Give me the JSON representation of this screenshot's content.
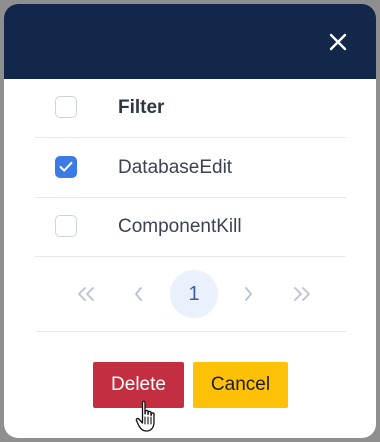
{
  "dialog": {
    "close_icon": "close-icon"
  },
  "table": {
    "header_label": "Filter",
    "rows": [
      {
        "label": "DatabaseEdit",
        "checked": true
      },
      {
        "label": "ComponentKill",
        "checked": false
      }
    ]
  },
  "pagination": {
    "first_icon": "double-chevron-left-icon",
    "prev_icon": "chevron-left-icon",
    "current_page": "1",
    "next_icon": "chevron-right-icon",
    "last_icon": "double-chevron-right-icon"
  },
  "actions": {
    "delete_label": "Delete",
    "cancel_label": "Cancel"
  },
  "colors": {
    "header_bg": "#13274b",
    "checkbox_checked": "#3a7be6",
    "delete_bg": "#c32f40",
    "cancel_bg": "#ffc107",
    "current_page_bg": "#eaf1fd"
  }
}
